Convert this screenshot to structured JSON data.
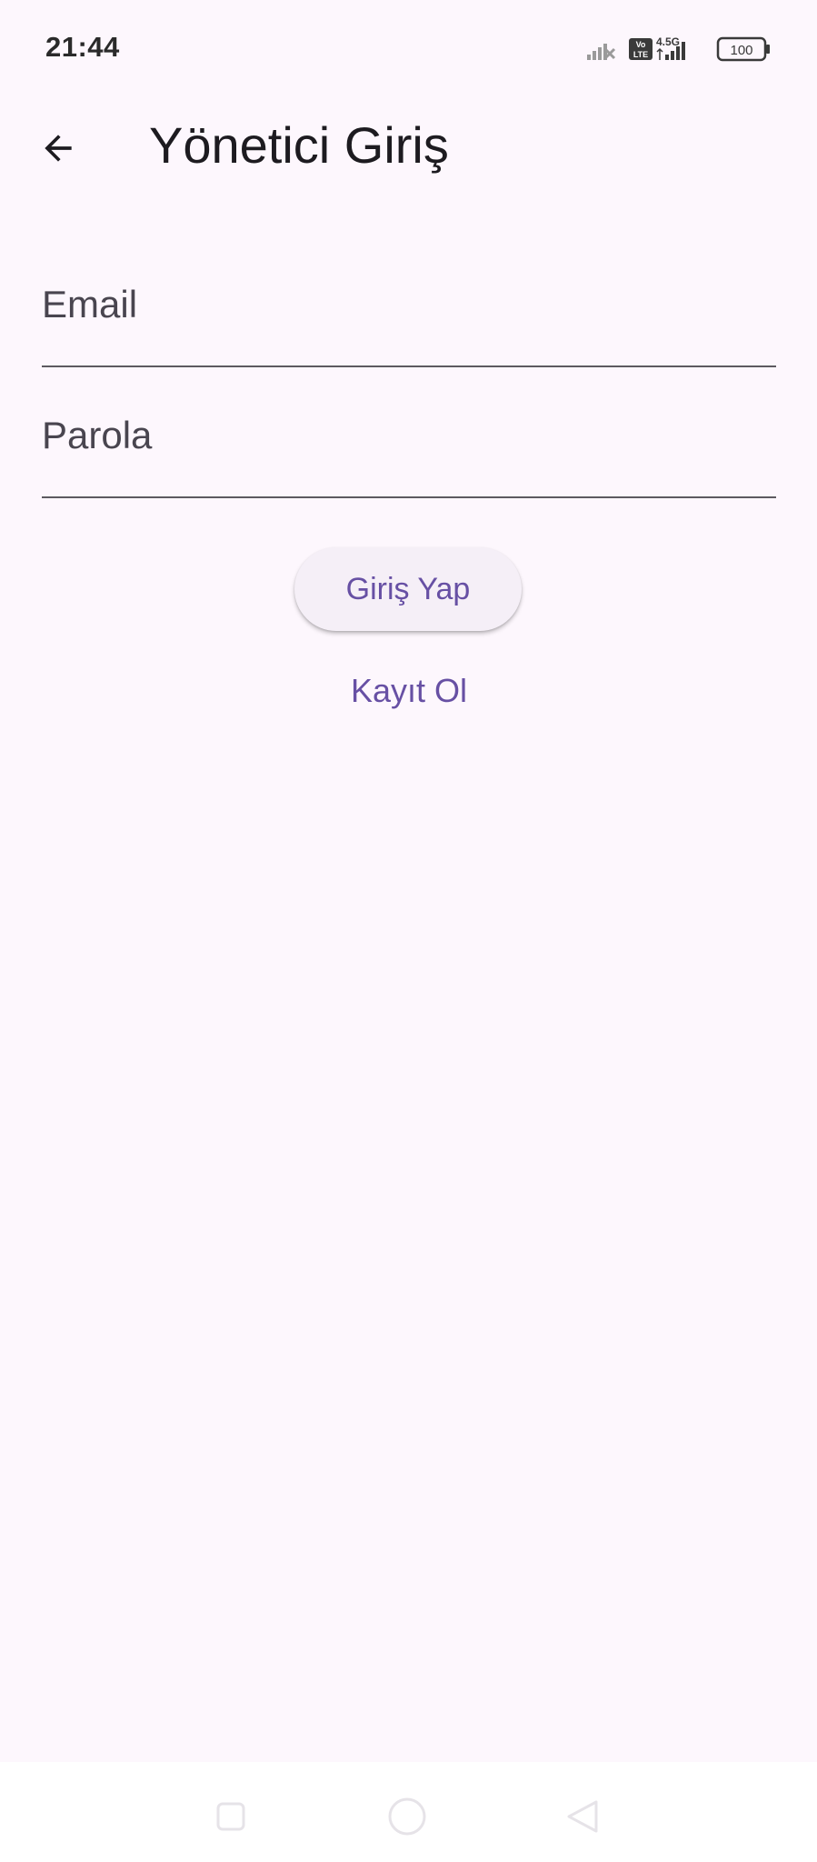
{
  "status_bar": {
    "time": "21:44",
    "network_label": "4.5G",
    "volte_label": "Vo LTE",
    "battery_level": "100",
    "icons": [
      "signal-off-icon",
      "volte-icon",
      "cellular-signal-icon",
      "battery-icon"
    ]
  },
  "app_bar": {
    "title": "Yönetici Giriş",
    "back_icon": "arrow-back-icon"
  },
  "form": {
    "email": {
      "placeholder": "Email",
      "value": ""
    },
    "password": {
      "placeholder": "Parola",
      "value": ""
    },
    "login_label": "Giriş Yap",
    "register_label": "Kayıt Ol"
  },
  "nav_bar": {
    "icons": [
      "recent-apps-icon",
      "home-icon",
      "back-icon"
    ]
  },
  "colors": {
    "background": "#fdf7fd",
    "primary": "#6750a4",
    "button_surface": "#f5eff7",
    "underline": "#5c5a60",
    "text": "#1d1b20"
  }
}
